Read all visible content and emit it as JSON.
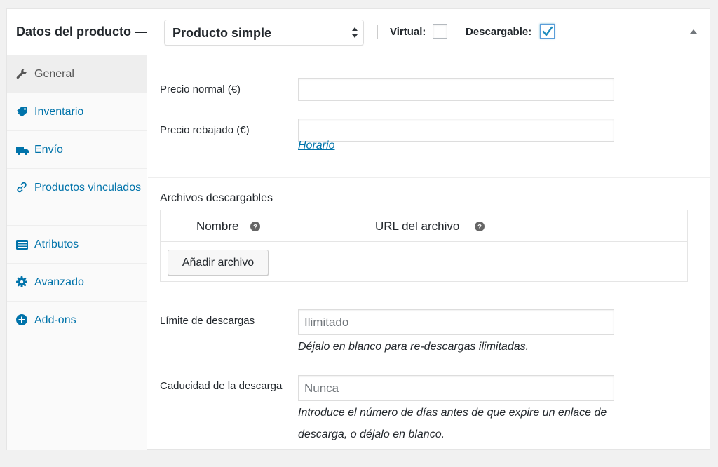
{
  "header": {
    "title": "Datos del producto —",
    "product_type": "Producto simple",
    "virtual_label": "Virtual:",
    "virtual_checked": false,
    "downloadable_label": "Descargable:",
    "downloadable_checked": true
  },
  "sidebar": {
    "items": [
      {
        "label": "General",
        "icon": "wrench-icon",
        "active": true
      },
      {
        "label": "Inventario",
        "icon": "tag-icon",
        "active": false
      },
      {
        "label": "Envío",
        "icon": "truck-icon",
        "active": false
      },
      {
        "label": "Productos vinculados",
        "icon": "link-icon",
        "active": false
      },
      {
        "label": "Atributos",
        "icon": "list-icon",
        "active": false
      },
      {
        "label": "Avanzado",
        "icon": "gear-icon",
        "active": false
      },
      {
        "label": "Add-ons",
        "icon": "plus-circle-icon",
        "active": false
      }
    ]
  },
  "general": {
    "regular_price_label": "Precio normal (€)",
    "regular_price_value": "",
    "sale_price_label": "Precio rebajado (€)",
    "sale_price_value": "",
    "schedule_link": "Horario"
  },
  "downloads": {
    "section_title": "Archivos descargables",
    "col_name": "Nombre",
    "col_url": "URL del archivo",
    "add_button": "Añadir archivo",
    "limit_label": "Límite de descargas",
    "limit_placeholder": "Ilimitado",
    "limit_hint": "Déjalo en blanco para re-descargas ilimitadas.",
    "expiry_label": "Caducidad de la descarga",
    "expiry_placeholder": "Nunca",
    "expiry_hint_line1": "Introduce el número de días antes de que expire un enlace de",
    "expiry_hint_line2": "descarga, o déjalo en blanco."
  },
  "colors": {
    "link": "#0073aa",
    "text": "#23282d",
    "checkbox_accent": "#1e8cbe"
  }
}
